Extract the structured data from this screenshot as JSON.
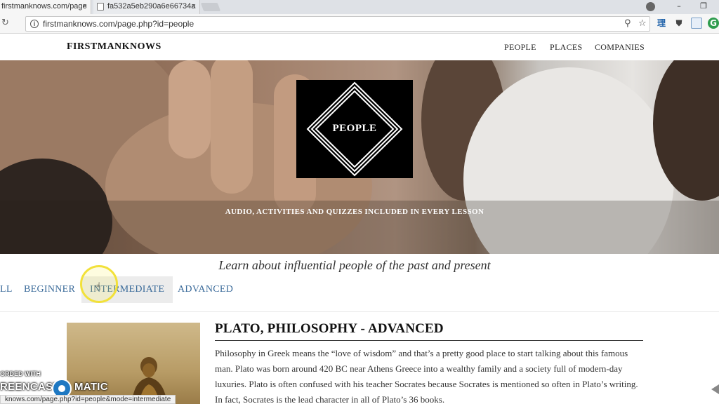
{
  "browser": {
    "tabs": [
      {
        "title": "firstmanknows.com/page",
        "close": "×"
      },
      {
        "title": "fa532a5eb290a6e66734a",
        "close": "×"
      }
    ],
    "window_controls": {
      "minimize": "–",
      "maximize": "❐"
    },
    "url": "firstmanknows.com/page.php?id=people",
    "reload_glyph": "↻",
    "search_glyph": "⚲",
    "star_glyph": "☆",
    "extensions": [
      "理",
      "⛊",
      "▢",
      "G"
    ]
  },
  "site": {
    "logo": "FIRSTMANKNOWS",
    "nav": [
      "PEOPLE",
      "PLACES",
      "COMPANIES"
    ]
  },
  "hero": {
    "title": "PEOPLE",
    "tagline": "AUDIO, ACTIVITIES AND QUIZZES INCLUDED IN EVERY LESSON"
  },
  "subtitle": "Learn about influential people of the past and present",
  "levels": {
    "all_partial": "LL",
    "beginner": "BEGINNER",
    "intermediate": "INTERMEDIATE",
    "advanced": "ADVANCED",
    "selected": "INTERMEDIATE"
  },
  "article": {
    "title": "PLATO, PHILOSOPHY - ADVANCED",
    "body": "Philosophy in Greek means the “love of wisdom” and that’s a pretty good place to start talking about this famous man. Plato was born around 420 BC near Athens Greece into a wealthy family and a society full of modern-day luxuries. Plato is often confused with his teacher Socrates because Socrates is mentioned so often in Plato’s writing. In fact, Socrates is the lead character in all of Plato’s 36 books."
  },
  "watermark": {
    "top": "ORDED WITH",
    "left": "REENCAST",
    "right": "MATIC"
  },
  "status_bar": "knows.com/page.php?id=people&mode=intermediate",
  "colors": {
    "link": "#3b6b9a",
    "highlight_ring": "#f2e13a"
  }
}
